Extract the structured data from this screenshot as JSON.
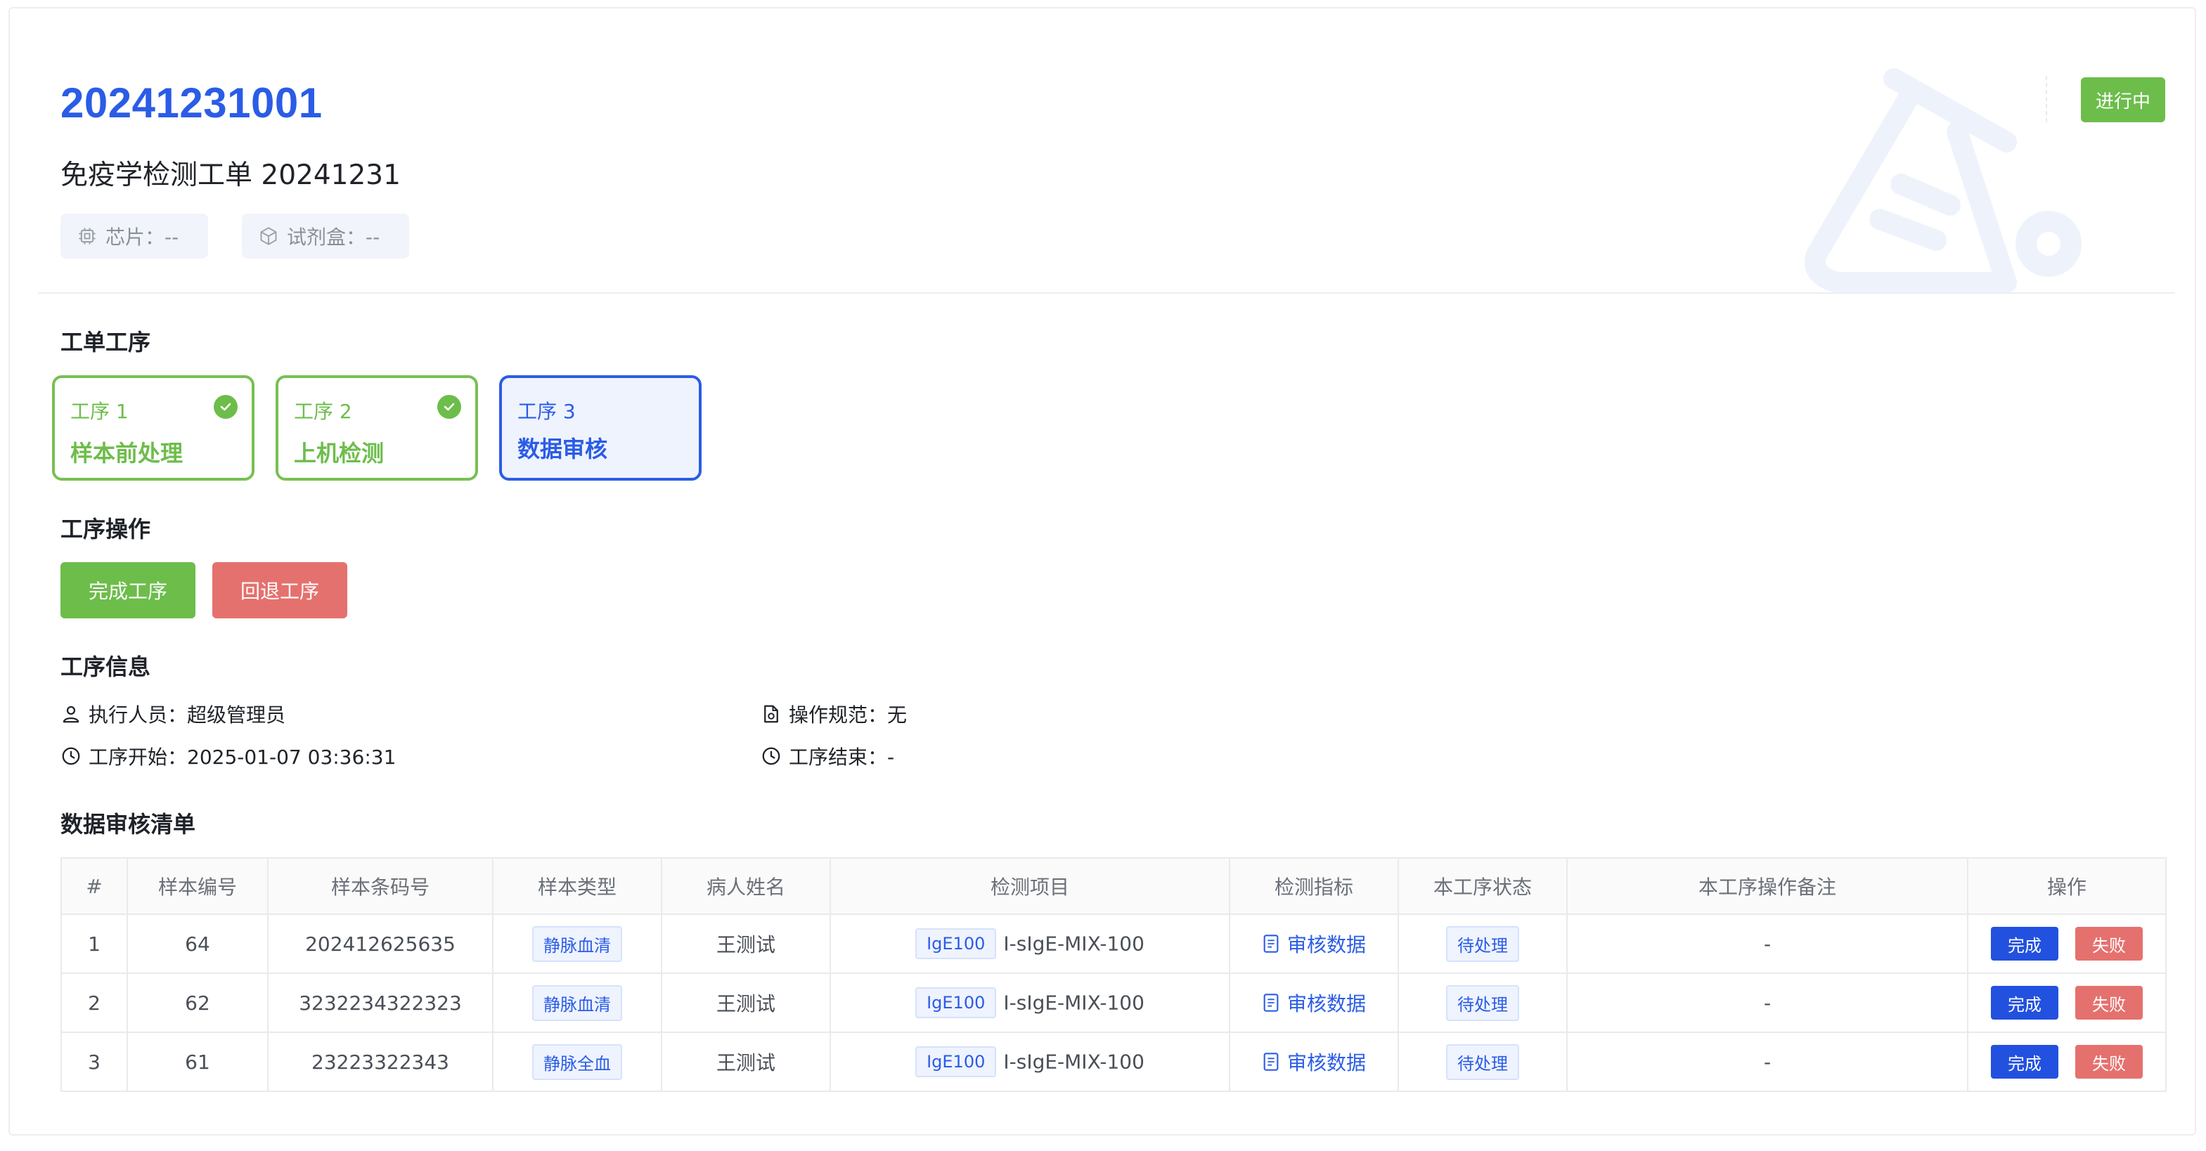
{
  "header": {
    "order_no": "20241231001",
    "order_title": "免疫学检测工单 20241231",
    "chip_label": "芯片：--",
    "kit_label": "试剂盒：--",
    "status": "进行中"
  },
  "sections": {
    "steps_title": "工单工序",
    "ops_title": "工序操作",
    "info_title": "工序信息",
    "list_title": "数据审核清单"
  },
  "steps": [
    {
      "num": "工序 1",
      "name": "样本前处理",
      "done": true
    },
    {
      "num": "工序 2",
      "name": "上机检测",
      "done": true
    },
    {
      "num": "工序 3",
      "name": "数据审核",
      "done": false
    }
  ],
  "ops": {
    "complete": "完成工序",
    "rollback": "回退工序"
  },
  "info": {
    "executor": "执行人员：超级管理员",
    "spec": "操作规范：无",
    "start": "工序开始：2025-01-07 03:36:31",
    "end": "工序结束：-"
  },
  "table": {
    "headers": [
      "#",
      "样本编号",
      "样本条码号",
      "样本类型",
      "病人姓名",
      "检测项目",
      "检测指标",
      "本工序状态",
      "本工序操作备注",
      "操作"
    ],
    "rows": [
      {
        "idx": "1",
        "sample_no": "64",
        "barcode": "202412625635",
        "type": "静脉血清",
        "patient": "王测试",
        "item_tag": "IgE100",
        "item_name": "I-sIgE-MIX-100",
        "indicator": "审核数据",
        "status": "待处理",
        "note": "-",
        "ok": "完成",
        "fail": "失败"
      },
      {
        "idx": "2",
        "sample_no": "62",
        "barcode": "3232234322323",
        "type": "静脉血清",
        "patient": "王测试",
        "item_tag": "IgE100",
        "item_name": "I-sIgE-MIX-100",
        "indicator": "审核数据",
        "status": "待处理",
        "note": "-",
        "ok": "完成",
        "fail": "失败"
      },
      {
        "idx": "3",
        "sample_no": "61",
        "barcode": "23223322343",
        "type": "静脉全血",
        "patient": "王测试",
        "item_tag": "IgE100",
        "item_name": "I-sIgE-MIX-100",
        "indicator": "审核数据",
        "status": "待处理",
        "note": "-",
        "ok": "完成",
        "fail": "失败"
      }
    ]
  },
  "colors": {
    "primary": "#2b5ce6",
    "success": "#6dbd4b",
    "danger": "#e5716e"
  },
  "icons": {
    "chip": "chip-icon",
    "kit": "box-icon",
    "user": "user-icon",
    "spec": "file-spec-icon",
    "clock": "clock-icon",
    "check": "check-circle-icon",
    "doc": "document-icon",
    "watermark": "test-tube-icon"
  }
}
